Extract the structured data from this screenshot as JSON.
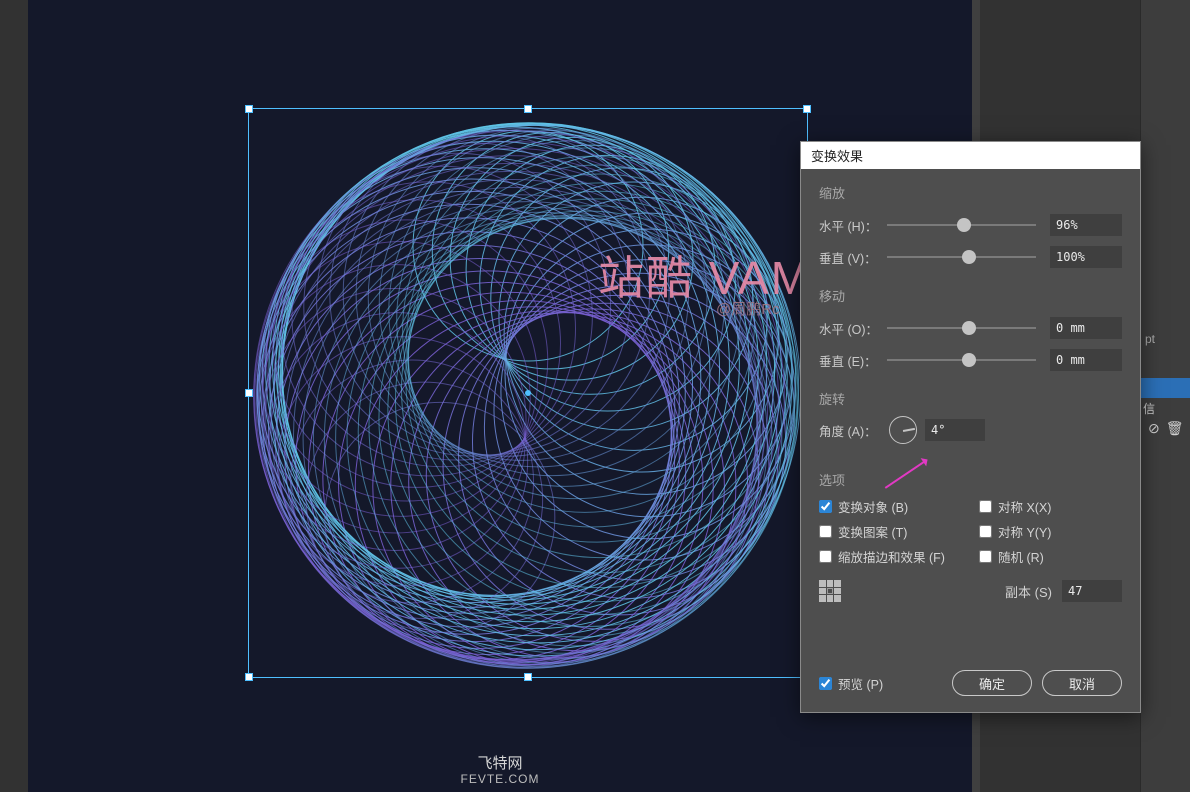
{
  "canvas": {
    "watermark_main": "站酷 VAMPIREE",
    "watermark_sub": "@周鹏Rc",
    "footer_cn": "飞特网",
    "footer_en": "FEVTE.COM"
  },
  "right_panel": {
    "unit_hint": "pt",
    "char_hint": "信"
  },
  "dialog": {
    "title": "变换效果",
    "scale": {
      "label": "缩放",
      "h_label": "水平 (H)：",
      "h_value": "96%",
      "v_label": "垂直 (V)：",
      "v_value": "100%"
    },
    "move": {
      "label": "移动",
      "h_label": "水平 (O)：",
      "h_value": "0 mm",
      "v_label": "垂直 (E)：",
      "v_value": "0 mm"
    },
    "rotate": {
      "label": "旋转",
      "angle_label": "角度 (A)：",
      "angle_value": "4°"
    },
    "options": {
      "label": "选项",
      "transform_objects": "变换对象 (B)",
      "reflect_x": "对称 X(X)",
      "transform_patterns": "变换图案 (T)",
      "reflect_y": "对称 Y(Y)",
      "scale_strokes": "缩放描边和效果 (F)",
      "random": "随机 (R)",
      "checked": {
        "transform_objects": true,
        "reflect_x": false,
        "transform_patterns": false,
        "reflect_y": false,
        "scale_strokes": false,
        "random": false
      }
    },
    "copies": {
      "label": "副本 (S)",
      "value": "47"
    },
    "preview": {
      "label": "预览 (P)",
      "checked": true
    },
    "ok": "确定",
    "cancel": "取消"
  },
  "chart_data": {
    "type": "spiral-transform-preview",
    "base_circle_radius_px": 130,
    "copies": 47,
    "scale_step_percent": 96,
    "rotate_step_deg": 4,
    "stroke_gradient": [
      "#5fc6e8",
      "#7a5fd4"
    ]
  }
}
